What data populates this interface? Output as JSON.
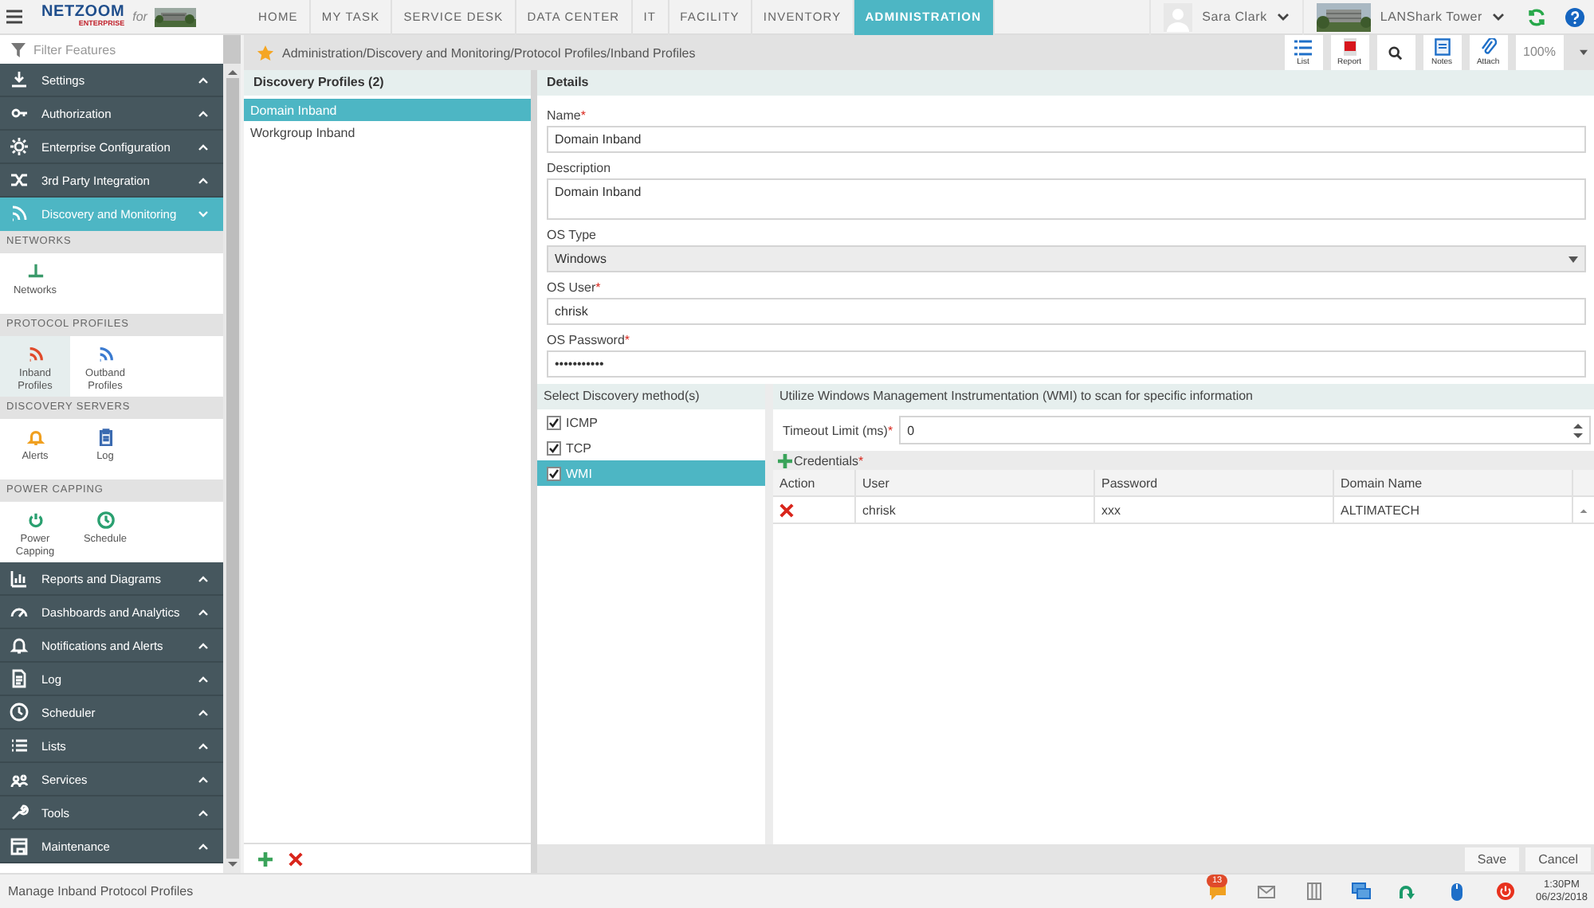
{
  "top_bar": {
    "brand": "NETZOOM",
    "brand_sub": "ENTERPRISE",
    "brand_for": "for",
    "tabs": [
      {
        "label": "HOME",
        "selected": false
      },
      {
        "label": "MY TASK",
        "selected": false
      },
      {
        "label": "SERVICE DESK",
        "selected": false
      },
      {
        "label": "DATA CENTER",
        "selected": false
      },
      {
        "label": "IT",
        "selected": false
      },
      {
        "label": "FACILITY",
        "selected": false
      },
      {
        "label": "INVENTORY",
        "selected": false
      },
      {
        "label": "ADMINISTRATION",
        "selected": true
      }
    ],
    "user": "Sara Clark",
    "site": "LANShark Tower"
  },
  "sidebar": {
    "filter_placeholder": "Filter Features",
    "menu": [
      {
        "label": "Settings",
        "expanded": false
      },
      {
        "label": "Authorization",
        "expanded": false
      },
      {
        "label": "Enterprise Configuration",
        "expanded": false
      },
      {
        "label": "3rd Party Integration",
        "expanded": false
      },
      {
        "label": "Discovery and Monitoring",
        "expanded": true,
        "sections": [
          {
            "title": "NETWORKS",
            "tiles": [
              {
                "label": "Networks",
                "selected": false
              }
            ]
          },
          {
            "title": "PROTOCOL PROFILES",
            "tiles": [
              {
                "label": "Inband Profiles",
                "selected": true
              },
              {
                "label": "Outband Profiles",
                "selected": false
              }
            ]
          },
          {
            "title": "DISCOVERY SERVERS",
            "tiles": [
              {
                "label": "Alerts",
                "selected": false
              },
              {
                "label": "Log",
                "selected": false
              }
            ]
          },
          {
            "title": "POWER CAPPING",
            "tiles": [
              {
                "label": "Power Capping",
                "selected": false
              },
              {
                "label": "Schedule",
                "selected": false
              }
            ]
          }
        ]
      },
      {
        "label": "Reports and Diagrams",
        "expanded": false
      },
      {
        "label": "Dashboards and Analytics",
        "expanded": false
      },
      {
        "label": "Notifications and Alerts",
        "expanded": false
      },
      {
        "label": "Log",
        "expanded": false
      },
      {
        "label": "Scheduler",
        "expanded": false
      },
      {
        "label": "Lists",
        "expanded": false
      },
      {
        "label": "Services",
        "expanded": false
      },
      {
        "label": "Tools",
        "expanded": false
      },
      {
        "label": "Maintenance",
        "expanded": false
      }
    ]
  },
  "breadcrumb": "Administration/Discovery and Monitoring/Protocol Profiles/Inband Profiles",
  "toolbar": {
    "buttons": [
      {
        "label": "List"
      },
      {
        "label": "Report"
      }
    ],
    "buttons_after": [
      {
        "label": "Notes"
      },
      {
        "label": "Attach"
      }
    ],
    "zoom": "100%"
  },
  "profiles": {
    "title": "Discovery Profiles (2)",
    "items": [
      {
        "label": "Domain Inband",
        "selected": true
      },
      {
        "label": "Workgroup Inband",
        "selected": false
      }
    ]
  },
  "details": {
    "title": "Details",
    "fields": [
      {
        "kind": "text",
        "label": "Name",
        "required_mark": "*",
        "value": "Domain Inband"
      },
      {
        "kind": "textarea",
        "label": "Description",
        "value": "Domain Inband"
      },
      {
        "kind": "select",
        "label": "OS Type",
        "value": "Windows"
      },
      {
        "kind": "text",
        "label": "OS User",
        "required_mark": "*",
        "value": "chrisk"
      },
      {
        "kind": "text",
        "label": "OS Password",
        "required_mark": "*",
        "value": "•••••••••••"
      }
    ]
  },
  "methods": {
    "title": "Select Discovery method(s)",
    "items": [
      {
        "label": "ICMP",
        "checked": true,
        "selected": false
      },
      {
        "label": "TCP",
        "checked": true,
        "selected": false
      },
      {
        "label": "WMI",
        "checked": true,
        "selected": true
      }
    ]
  },
  "wmi": {
    "title": "Utilize Windows Management Instrumentation (WMI) to scan for specific information",
    "timeout": {
      "label": "Timeout Limit (ms)",
      "required_mark": "*",
      "value": "0"
    },
    "credentials": {
      "label": "Credentials",
      "required_mark": "*"
    },
    "columns": [
      "Action",
      "User",
      "Password",
      "Domain Name"
    ],
    "rows": [
      [
        "",
        "chrisk",
        "xxx",
        "ALTIMATECH"
      ]
    ]
  },
  "actions": [
    "Save",
    "Cancel"
  ],
  "status_bar": {
    "message": "Manage Inband Protocol Profiles",
    "notifications": "13",
    "time": "1:30PM",
    "date": "06/23/2018"
  }
}
